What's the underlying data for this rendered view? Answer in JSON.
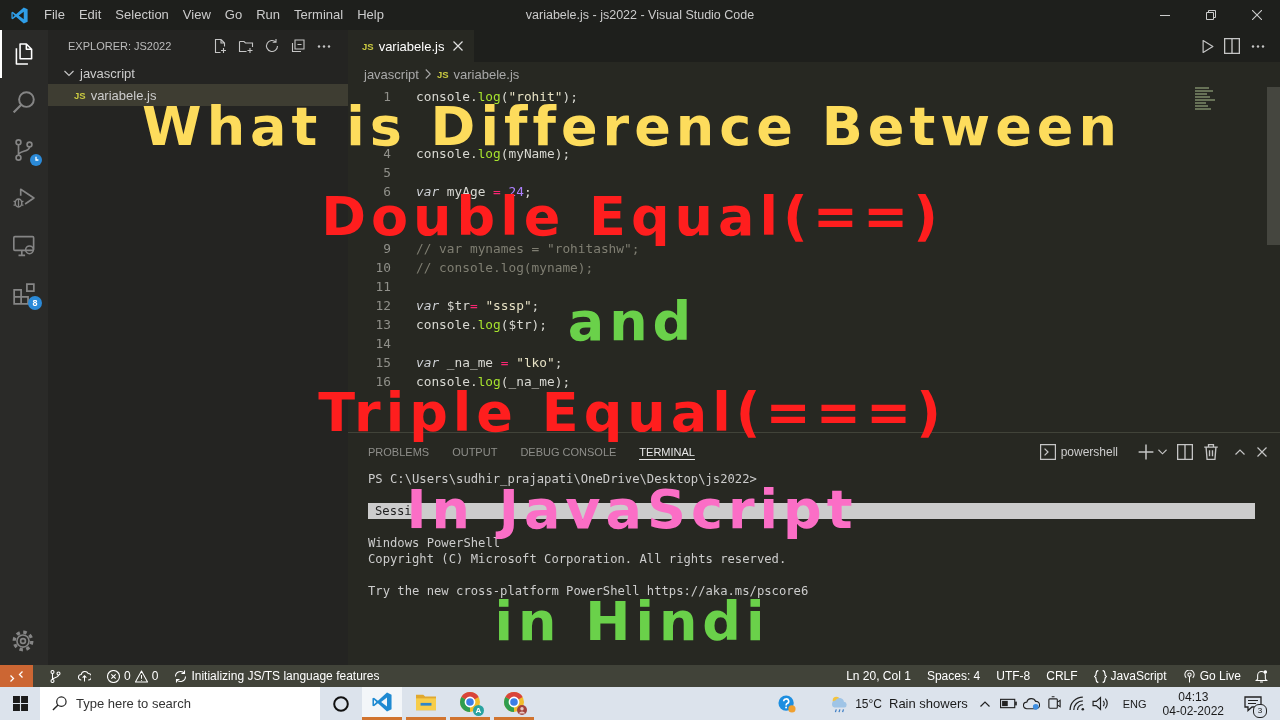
{
  "window": {
    "title": "variabele.js - js2022 - Visual Studio Code"
  },
  "menu": [
    "File",
    "Edit",
    "Selection",
    "View",
    "Go",
    "Run",
    "Terminal",
    "Help"
  ],
  "activity_bar": [
    {
      "kind": "files",
      "selected": true
    },
    {
      "kind": "search",
      "selected": false
    },
    {
      "kind": "source-control",
      "selected": false
    },
    {
      "kind": "debug",
      "selected": false
    },
    {
      "kind": "remote",
      "selected": false
    },
    {
      "kind": "extensions",
      "selected": false,
      "badge": "8"
    }
  ],
  "sidebar": {
    "title": "EXPLORER: JS2022",
    "tree": [
      {
        "label": "javascript",
        "expanded": true,
        "selected": false,
        "children": [
          {
            "label": "variabele.js",
            "file_icon": "JS",
            "selected": true
          }
        ]
      }
    ]
  },
  "editor": {
    "tabs": [
      {
        "label": "variabele.js",
        "file_icon": "JS",
        "selected": true
      }
    ],
    "breadcrumb": [
      {
        "label": "javascript"
      },
      {
        "label": "variabele.js",
        "file_icon": "JS"
      }
    ],
    "lines": [
      {
        "kind": "code",
        "number": "1",
        "tokens": [
          {
            "text": "console.",
            "kind": "plain"
          },
          {
            "text": "log",
            "kind": "func"
          },
          {
            "text": "(",
            "kind": "plain"
          },
          {
            "text": "\"rohit\"",
            "kind": "string"
          },
          {
            "text": ");",
            "kind": "plain"
          }
        ]
      },
      {
        "kind": "covered"
      },
      {
        "kind": "covered"
      },
      {
        "kind": "code",
        "number": "4",
        "tokens": [
          {
            "text": "console.",
            "kind": "plain"
          },
          {
            "text": "log",
            "kind": "func"
          },
          {
            "text": "(myName);",
            "kind": "plain"
          }
        ]
      },
      {
        "kind": "code",
        "number": "5"
      },
      {
        "kind": "code",
        "number": "6",
        "tokens": [
          {
            "text": "var",
            "kind": "keyword"
          },
          {
            "text": " myAge ",
            "kind": "plain"
          },
          {
            "text": "=",
            "kind": "operator"
          },
          {
            "text": " 24",
            "kind": "number"
          },
          {
            "text": ";",
            "kind": "plain"
          }
        ]
      },
      {
        "kind": "covered"
      },
      {
        "kind": "covered"
      },
      {
        "kind": "code",
        "number": "9",
        "tokens": [
          {
            "text": "// var mynames = \"rohitashw\";",
            "kind": "comment"
          }
        ]
      },
      {
        "kind": "code",
        "number": "10",
        "tokens": [
          {
            "text": "// console.log(myname);",
            "kind": "comment"
          }
        ]
      },
      {
        "kind": "code",
        "number": "11"
      },
      {
        "kind": "code",
        "number": "12",
        "tokens": [
          {
            "text": "var",
            "kind": "keyword"
          },
          {
            "text": " $tr",
            "kind": "plain"
          },
          {
            "text": "=",
            "kind": "operator"
          },
          {
            "text": " \"sssp\"",
            "kind": "string"
          },
          {
            "text": ";",
            "kind": "plain"
          }
        ]
      },
      {
        "kind": "code",
        "number": "13",
        "tokens": [
          {
            "text": "console.",
            "kind": "plain"
          },
          {
            "text": "log",
            "kind": "func"
          },
          {
            "text": "($tr);",
            "kind": "plain"
          }
        ]
      },
      {
        "kind": "code",
        "number": "14"
      },
      {
        "kind": "code",
        "number": "15",
        "tokens": [
          {
            "text": "var",
            "kind": "keyword"
          },
          {
            "text": " _na_me ",
            "kind": "plain"
          },
          {
            "text": "=",
            "kind": "operator"
          },
          {
            "text": " \"lko\"",
            "kind": "string"
          },
          {
            "text": ";",
            "kind": "plain"
          }
        ]
      },
      {
        "kind": "code",
        "number": "16",
        "tokens": [
          {
            "text": "console.",
            "kind": "plain"
          },
          {
            "text": "log",
            "kind": "func"
          },
          {
            "text": "(_na_me);",
            "kind": "plain"
          }
        ]
      },
      {
        "kind": "covered"
      },
      {
        "kind": "covered"
      }
    ]
  },
  "panel": {
    "tabs": [
      {
        "label": "PROBLEMS",
        "selected": false
      },
      {
        "label": "OUTPUT",
        "selected": false
      },
      {
        "label": "DEBUG CONSOLE",
        "selected": false
      },
      {
        "label": "TERMINAL",
        "selected": true
      }
    ],
    "terminal_name": "powershell",
    "terminal": {
      "paragraphs": [
        {
          "lines": [
            {
              "text": "PS C:\\Users\\sudhir_prajapati\\OneDrive\\Desktop\\js2022>",
              "highlighted": false
            }
          ]
        },
        {
          "lines": [
            {
              "text": "Sessi",
              "highlighted": true
            }
          ]
        },
        {
          "lines": [
            {
              "text": "Windows PowerShell",
              "highlighted": false
            },
            {
              "text": "Copyright (C) Microsoft Corporation. All rights reserved.",
              "highlighted": false
            }
          ]
        },
        {
          "lines": [
            {
              "text": "Try the new cross-platform PowerShell https://aka.ms/pscore6",
              "highlighted": false
            }
          ]
        }
      ]
    }
  },
  "status_bar": {
    "errors": "0",
    "warnings": "0",
    "message": "Initializing JS/TS language features",
    "right": [
      {
        "kind": "plain",
        "text": "Ln 20, Col 1"
      },
      {
        "kind": "plain",
        "text": "Spaces: 4"
      },
      {
        "kind": "plain",
        "text": "UTF-8"
      },
      {
        "kind": "plain",
        "text": "CRLF"
      },
      {
        "kind": "language",
        "text": "JavaScript"
      },
      {
        "kind": "live",
        "text": "Go Live"
      }
    ]
  },
  "taskbar": {
    "search": {
      "placeholder": "Type here to search"
    },
    "apps": [
      {
        "kind": "code",
        "selected": true,
        "running": true
      },
      {
        "kind": "folder",
        "selected": false,
        "running": true
      },
      {
        "kind": "browser",
        "selected": false,
        "running": true,
        "badge": "A"
      },
      {
        "kind": "browser-profile",
        "selected": false,
        "running": true
      }
    ],
    "weather": {
      "temperature": "15°C",
      "condition": "Rain showers"
    },
    "language": "ENG",
    "time": "04:13",
    "date": "04-02-2022",
    "notifications": "3"
  },
  "overlay": {
    "lines": [
      {
        "text": "What is Difference Between",
        "color": "#fddc5c"
      },
      {
        "text": "Double Equal(==)",
        "color": "#ff1e1e"
      },
      {
        "text": "and",
        "color": "#6ad14a"
      },
      {
        "text": "Triple Equal(===)",
        "color": "#ff1e1e"
      },
      {
        "text": "In JavaScript",
        "color": "#fb6ec6"
      },
      {
        "text": "in Hindi",
        "color": "#6ad14a"
      }
    ]
  }
}
